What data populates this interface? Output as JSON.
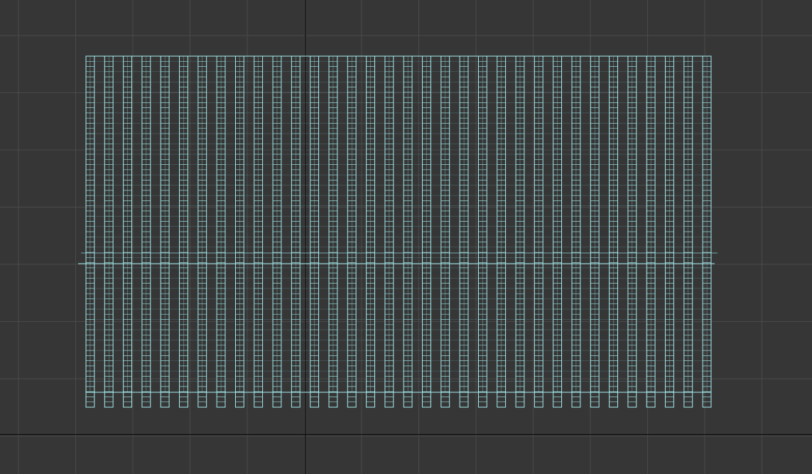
{
  "viewport": {
    "view": "orthographic-front",
    "background_color": "#363636",
    "grid_color": "#4a4a4a",
    "axis_color": "#0d0d0d",
    "wireframe_color": "#a6eef0"
  },
  "scene": {
    "object": "slatted-panel-wireframe",
    "selected": true,
    "slat_count": 34,
    "slat_spacing_units": 1,
    "horizontal_subdivisions": 68
  }
}
